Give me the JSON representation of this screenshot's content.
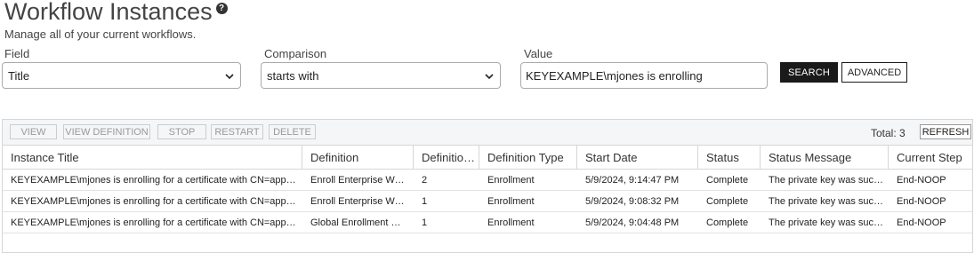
{
  "header": {
    "title": "Workflow Instances",
    "help_icon": "question-circle-icon",
    "subtitle": "Manage all of your current workflows."
  },
  "search": {
    "field_label": "Field",
    "field_value": "Title",
    "comparison_label": "Comparison",
    "comparison_value": "starts with",
    "value_label": "Value",
    "value_text": "KEYEXAMPLE\\mjones is enrolling",
    "search_button": "SEARCH",
    "advanced_button": "ADVANCED"
  },
  "toolbar": {
    "view": "VIEW",
    "view_definition": "VIEW DEFINITION",
    "stop": "STOP",
    "restart": "RESTART",
    "delete": "DELETE",
    "total": "Total: 3",
    "refresh": "REFRESH"
  },
  "table": {
    "columns": [
      "Instance Title",
      "Definition",
      "Definition Version",
      "Definition Type",
      "Start Date",
      "Status",
      "Status Message",
      "Current Step"
    ],
    "rows": [
      {
        "title": "KEYEXAMPLE\\mjones is enrolling for a certificate with CN=appsrvr.keyexample.com",
        "definition": "Enroll Enterprise Web Server",
        "version": "2",
        "type": "Enrollment",
        "start": "5/9/2024, 9:14:47 PM",
        "status": "Complete",
        "message": "The private key was successfully retrieved",
        "step": "End-NOOP"
      },
      {
        "title": "KEYEXAMPLE\\mjones is enrolling for a certificate with CN=appsrvr.keyexample.com",
        "definition": "Enroll Enterprise Web Server",
        "version": "1",
        "type": "Enrollment",
        "start": "5/9/2024, 9:08:32 PM",
        "status": "Complete",
        "message": "The private key was successfully retrieved",
        "step": "End-NOOP"
      },
      {
        "title": "KEYEXAMPLE\\mjones is enrolling for a certificate with CN=appsrvr.keyexample.com",
        "definition": "Global Enrollment Workflow",
        "version": "1",
        "type": "Enrollment",
        "start": "5/9/2024, 9:04:48 PM",
        "status": "Complete",
        "message": "The private key was successfully retrieved",
        "step": "End-NOOP"
      }
    ]
  },
  "icons": {
    "dropdown": "chevron-down-icon"
  }
}
